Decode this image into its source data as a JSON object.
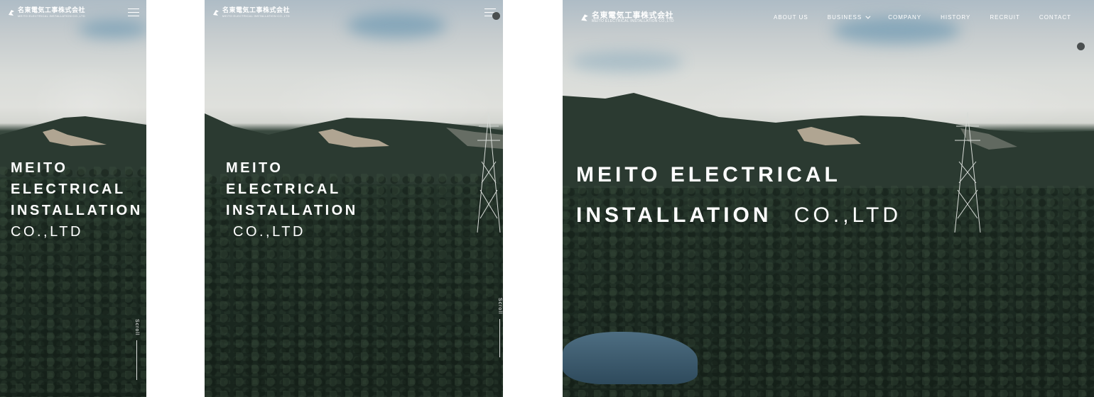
{
  "brand": {
    "name_jp": "名東電気工事株式会社",
    "name_en": "MEITO ELECTRICAL INSTALLATION CO.,LTD"
  },
  "nav": {
    "items": [
      {
        "label": "ABOUT US",
        "dropdown": false
      },
      {
        "label": "BUSINESS",
        "dropdown": true
      },
      {
        "label": "COMPANY",
        "dropdown": false
      },
      {
        "label": "HISTORY",
        "dropdown": false
      },
      {
        "label": "RECRUIT",
        "dropdown": false
      },
      {
        "label": "CONTACT",
        "dropdown": false
      }
    ]
  },
  "hero": {
    "narrow_lines": [
      "MEITO",
      "ELECTRICAL",
      "INSTALLATION",
      "CO.,LTD"
    ],
    "wide_line1": "MEITO ELECTRICAL",
    "wide_line2_bold": "INSTALLATION",
    "wide_line2_light": "CO.,LTD"
  },
  "scroll_label": "Scroll",
  "icons": {
    "menu": "hamburger-menu-icon",
    "logo": "meito-logo-mark-icon",
    "dropdown": "chevron-down-icon"
  },
  "colors": {
    "text": "#ffffff",
    "forest": "#1e2c23",
    "sky": "#dfe0dc",
    "dot": "#4a4f50"
  }
}
